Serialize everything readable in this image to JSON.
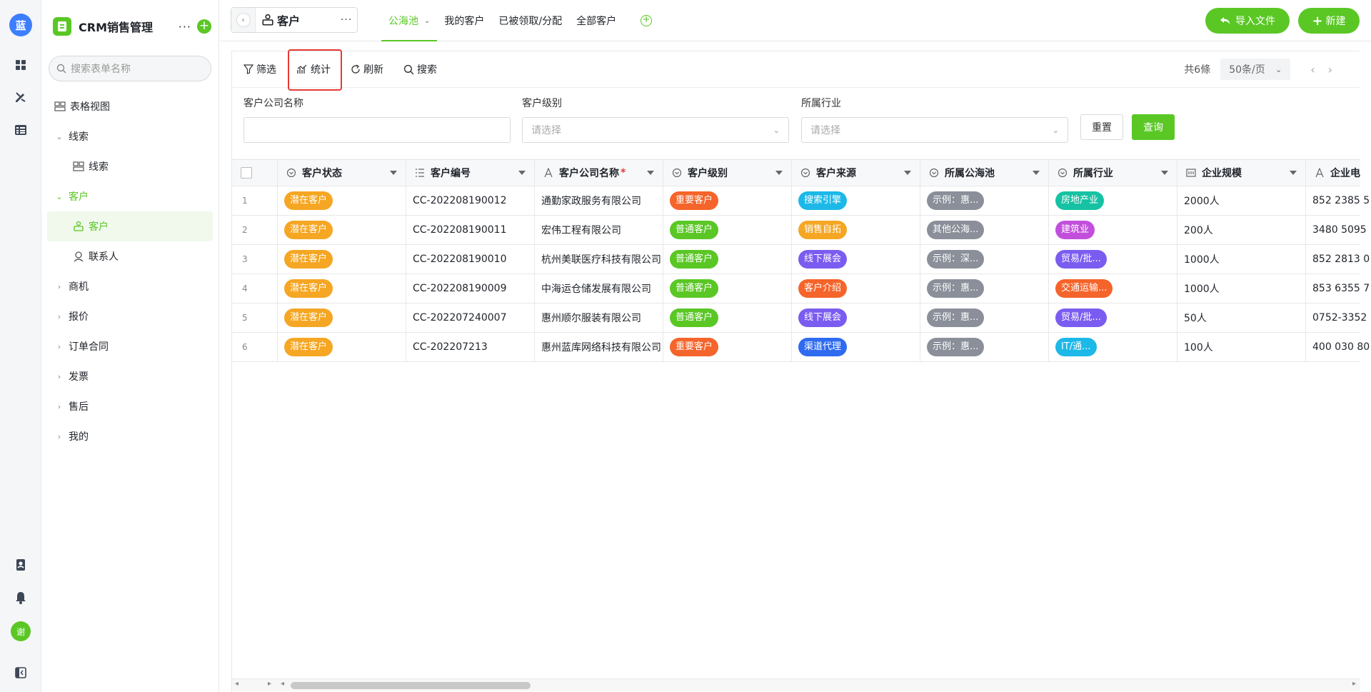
{
  "rail": {
    "logo_text": "蓝",
    "avatar_text": "谢"
  },
  "sidebar": {
    "app_title": "CRM销售管理",
    "more_label": "···",
    "add_label": "+",
    "search_placeholder": "搜索表单名称",
    "items": [
      {
        "label": "表格视图"
      },
      {
        "label": "线索"
      },
      {
        "label": "线索"
      },
      {
        "label": "客户"
      },
      {
        "label": "客户"
      },
      {
        "label": "联系人"
      },
      {
        "label": "商机"
      },
      {
        "label": "报价"
      },
      {
        "label": "订单合同"
      },
      {
        "label": "发票"
      },
      {
        "label": "售后"
      },
      {
        "label": "我的"
      }
    ]
  },
  "header": {
    "crumb_title": "客户",
    "crumb_more": "···",
    "tabs": [
      {
        "label": "公海池"
      },
      {
        "label": "我的客户"
      },
      {
        "label": "已被领取/分配"
      },
      {
        "label": "全部客户"
      }
    ],
    "add_tab": "+",
    "import_label": "导入文件",
    "new_label": "新建"
  },
  "toolbar": {
    "filter": "筛选",
    "stats": "统计",
    "refresh": "刷新",
    "search": "搜索",
    "total": "共6條",
    "page_size": "50条/页"
  },
  "filters": {
    "company_label": "客户公司名称",
    "level_label": "客户级别",
    "level_placeholder": "请选择",
    "industry_label": "所属行业",
    "industry_placeholder": "请选择",
    "reset": "重置",
    "query": "查询"
  },
  "table": {
    "headers": [
      "客户状态",
      "客户编号",
      "客户公司名称",
      "客户级别",
      "客户来源",
      "所属公海池",
      "所属行业",
      "企业规模",
      "企业电"
    ],
    "required_mark": "*",
    "rows": [
      {
        "idx": "1",
        "status": "潜在客户",
        "code": "CC-202208190012",
        "company": "通勤家政服务有限公司",
        "level": "重要客户",
        "source": "搜索引擎",
        "pool": "示例：惠...",
        "industry": "房地产业",
        "scale": "2000人",
        "phone": "852 2385 5"
      },
      {
        "idx": "2",
        "status": "潜在客户",
        "code": "CC-202208190011",
        "company": "宏伟工程有限公司",
        "level": "普通客户",
        "source": "销售自拓",
        "pool": "其他公海...",
        "industry": "建筑业",
        "scale": "200人",
        "phone": "3480 5095"
      },
      {
        "idx": "3",
        "status": "潜在客户",
        "code": "CC-202208190010",
        "company": "杭州美联医疗科技有限公司",
        "level": "普通客户",
        "source": "线下展会",
        "pool": "示例：深...",
        "industry": "贸易/批...",
        "scale": "1000人",
        "phone": "852 2813 0"
      },
      {
        "idx": "4",
        "status": "潜在客户",
        "code": "CC-202208190009",
        "company": "中海运仓储发展有限公司",
        "level": "普通客户",
        "source": "客户介绍",
        "pool": "示例：惠...",
        "industry": "交通运输...",
        "scale": "1000人",
        "phone": "853 6355 7"
      },
      {
        "idx": "5",
        "status": "潜在客户",
        "code": "CC-202207240007",
        "company": "惠州顺尔服装有限公司",
        "level": "普通客户",
        "source": "线下展会",
        "pool": "示例：惠...",
        "industry": "贸易/批...",
        "scale": "50人",
        "phone": "0752-3352"
      },
      {
        "idx": "6",
        "status": "潜在客户",
        "code": "CC-202207213",
        "company": "惠州蓝库网络科技有限公司",
        "level": "重要客户",
        "source": "渠道代理",
        "pool": "示例：惠...",
        "industry": "IT/通...",
        "scale": "100人",
        "phone": "400 030 80"
      }
    ]
  },
  "colors": {
    "accent": "#5ac725",
    "status": "#f5a623",
    "level_important": "#f5642a",
    "level_normal": "#5ac725",
    "pool": "#8a8f99",
    "source_search": "#1cb8e8",
    "source_sales": "#f5a623",
    "source_expo": "#7b5cf0",
    "source_referral": "#f5642a",
    "source_channel": "#2f6bf0",
    "ind_realestate": "#16c2a3",
    "ind_construction": "#c24fdc",
    "ind_trade": "#7b5cf0",
    "ind_transport": "#f5642a",
    "ind_it": "#1cb8e8"
  }
}
